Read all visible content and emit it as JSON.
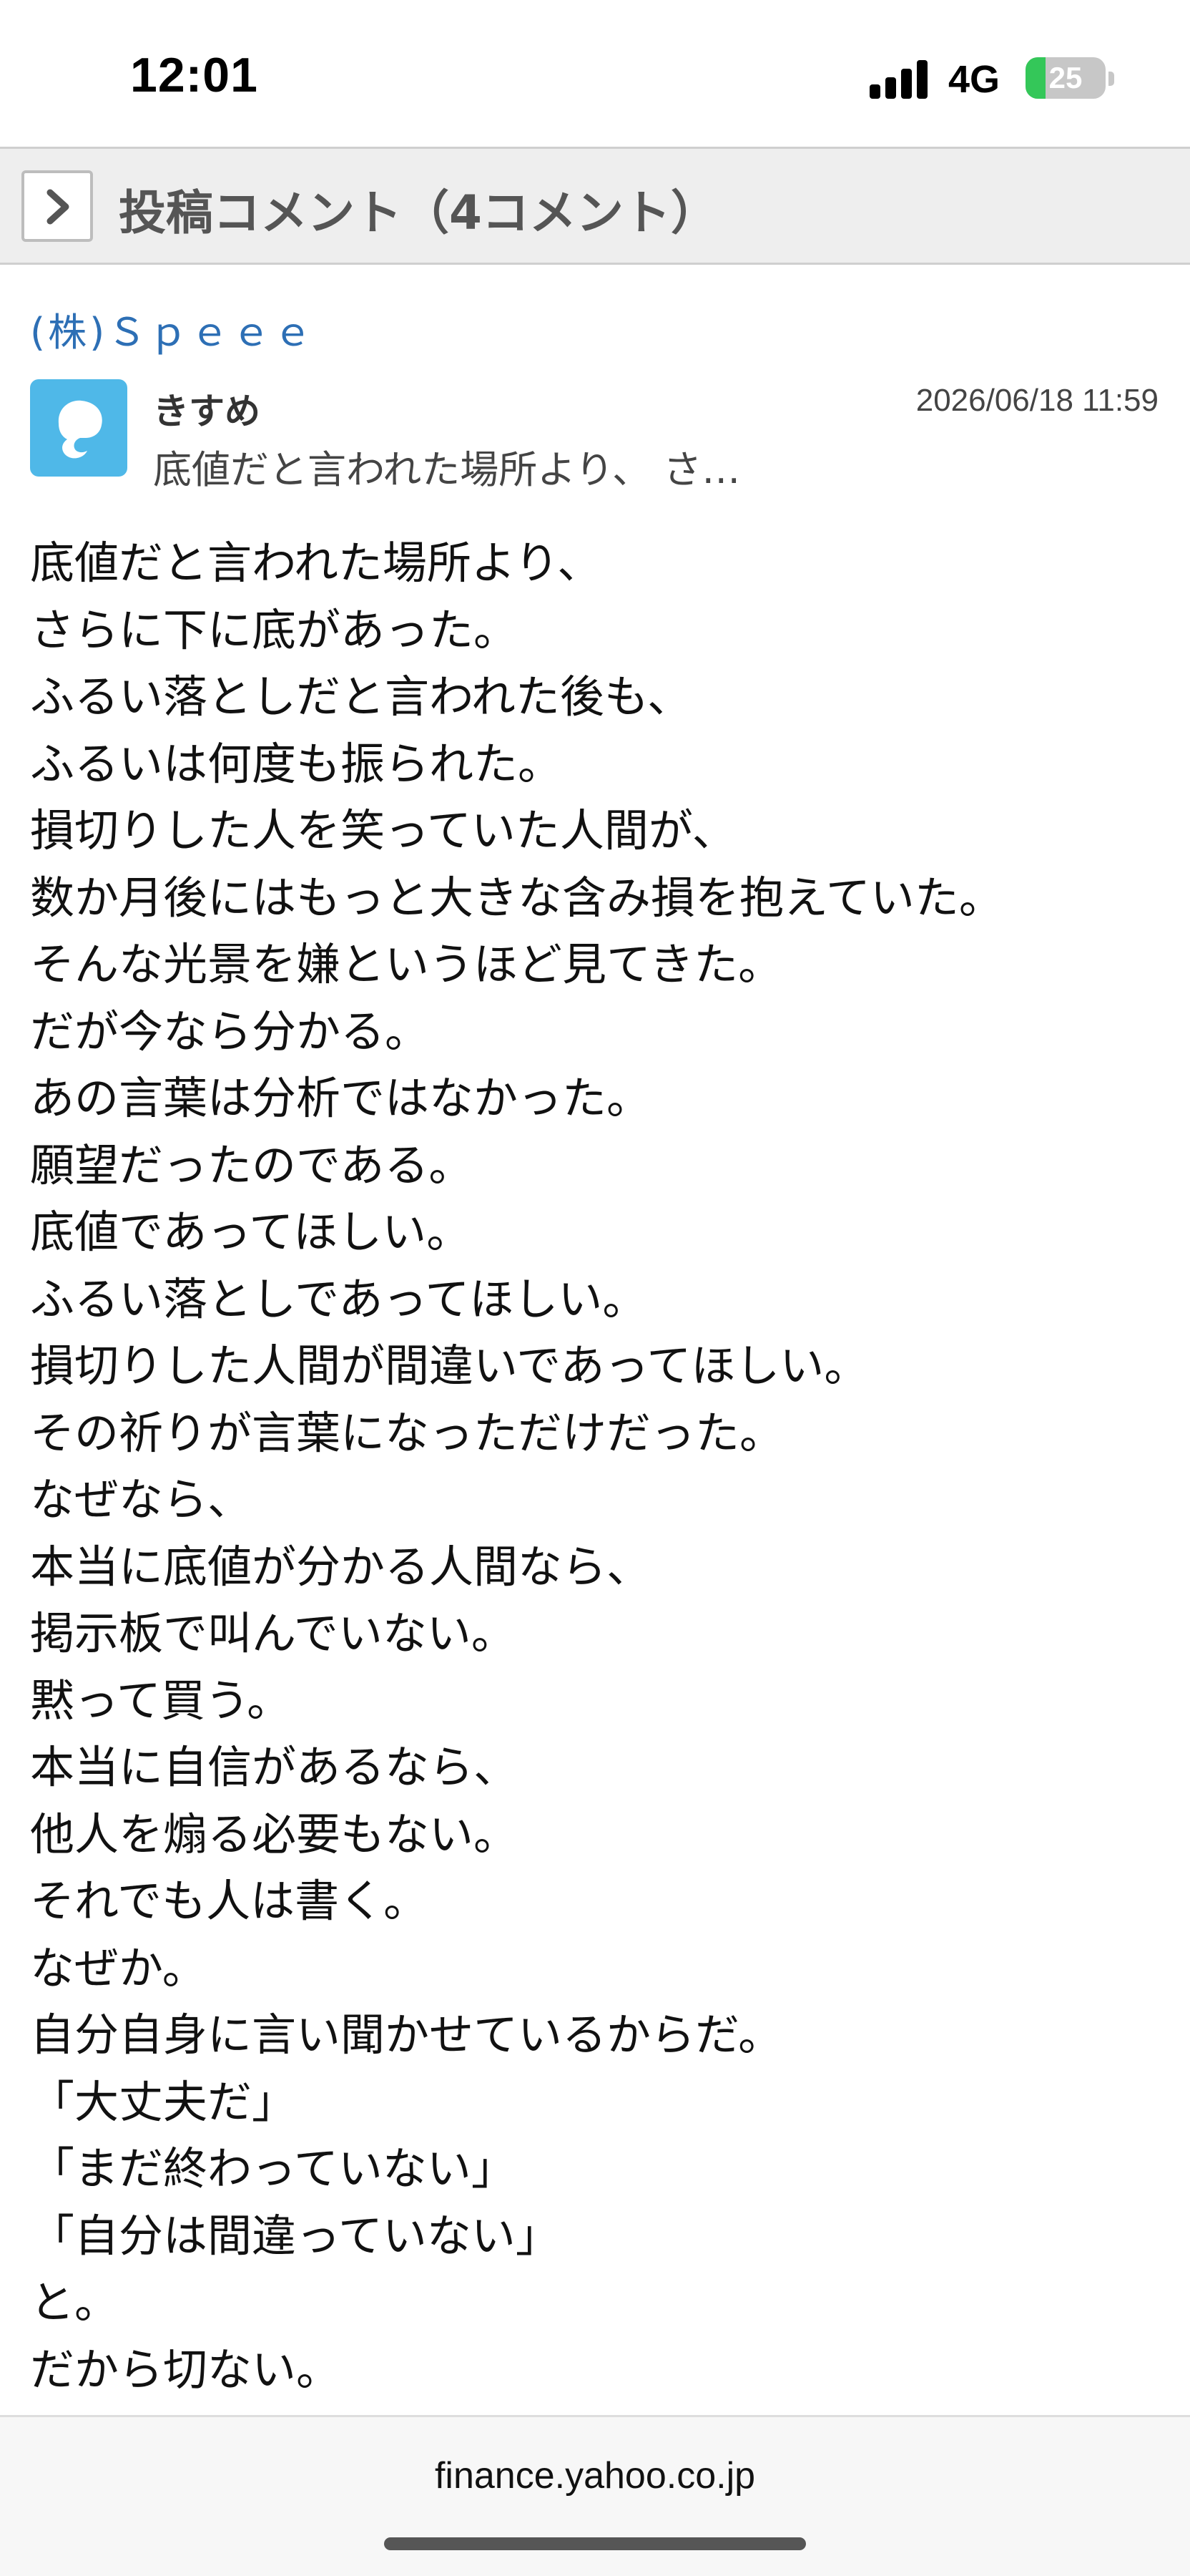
{
  "status_bar": {
    "time": "12:01",
    "network": "4G",
    "battery_level": "25",
    "battery_fraction": 0.25
  },
  "header": {
    "title": "投稿コメント（4コメント）",
    "back_icon": "chevron-right-icon"
  },
  "post": {
    "company": "(株)Ｓｐｅｅｅ",
    "username": "きすめ",
    "date": "2026/06/18 11:59",
    "preview": "底値だと言われた場所より、 さ…",
    "avatar_icon": "user-avatar-icon",
    "avatar_color": "#4fb8e8",
    "body_lines": [
      "底値だと言われた場所より、",
      "さらに下に底があった。",
      "ふるい落としだと言われた後も、",
      "ふるいは何度も振られた。",
      "損切りした人を笑っていた人間が、",
      "数か月後にはもっと大きな含み損を抱えていた。",
      "そんな光景を嫌というほど見てきた。",
      "だが今なら分かる。",
      "あの言葉は分析ではなかった。",
      "願望だったのである。",
      "底値であってほしい。",
      "ふるい落としであってほしい。",
      "損切りした人間が間違いであってほしい。",
      "その祈りが言葉になっただけだった。",
      "なぜなら、",
      "本当に底値が分かる人間なら、",
      "掲示板で叫んでいない。",
      "黙って買う。",
      "本当に自信があるなら、",
      "他人を煽る必要もない。",
      "それでも人は書く。",
      "なぜか。",
      "自分自身に言い聞かせているからだ。",
      "「大丈夫だ」",
      "「まだ終わっていない」",
      "「自分は間違っていない」",
      "と。",
      "だから切ない。"
    ]
  },
  "browser": {
    "domain": "finance.yahoo.co.jp"
  },
  "colors": {
    "link": "#2d6fb5",
    "header_bg": "#eeeeee",
    "battery_green": "#34c759"
  }
}
